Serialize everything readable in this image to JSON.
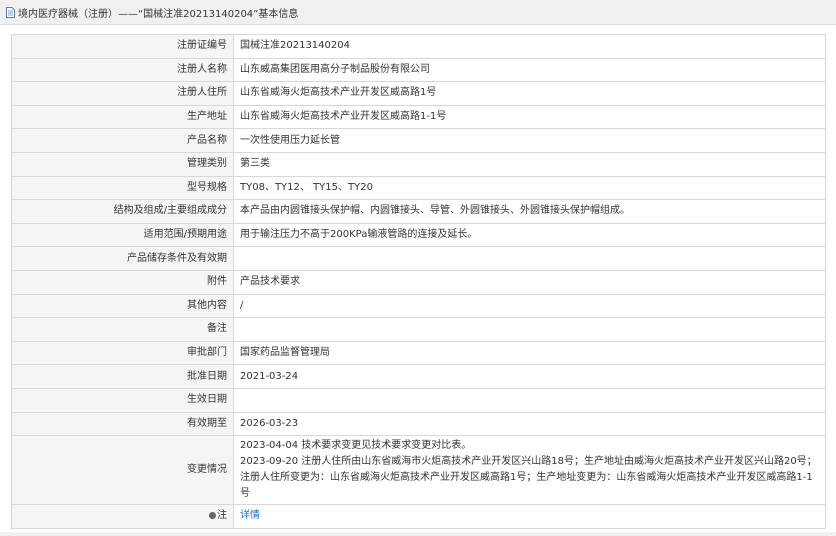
{
  "header": {
    "title": "境内医疗器械（注册）——“国械注准20213140204”基本信息"
  },
  "rows": [
    {
      "label": "注册证编号",
      "value": "国械注准20213140204"
    },
    {
      "label": "注册人名称",
      "value": "山东威高集团医用高分子制品股份有限公司"
    },
    {
      "label": "注册人住所",
      "value": "山东省威海火炬高技术产业开发区威高路1号"
    },
    {
      "label": "生产地址",
      "value": "山东省威海火炬高技术产业开发区威高路1-1号"
    },
    {
      "label": "产品名称",
      "value": "一次性使用压力延长管"
    },
    {
      "label": "管理类别",
      "value": "第三类"
    },
    {
      "label": "型号规格",
      "value": "TY08、TY12、 TY15、TY20"
    },
    {
      "label": "结构及组成/主要组成成分",
      "value": "本产品由内圆锥接头保护帽、内圆锥接头、导管、外圆锥接头、外圆锥接头保护帽组成。"
    },
    {
      "label": "适用范围/预期用途",
      "value": "用于输注压力不高于200KPa输液管路的连接及延长。"
    },
    {
      "label": "产品储存条件及有效期",
      "value": ""
    },
    {
      "label": "附件",
      "value": "产品技术要求"
    },
    {
      "label": "其他内容",
      "value": "/"
    },
    {
      "label": "备注",
      "value": ""
    },
    {
      "label": "审批部门",
      "value": "国家药品监督管理局"
    },
    {
      "label": "批准日期",
      "value": "2021-03-24"
    },
    {
      "label": "生效日期",
      "value": ""
    },
    {
      "label": "有效期至",
      "value": "2026-03-23"
    }
  ],
  "change": {
    "label": "变更情况",
    "line1": "2023-04-04 技术要求变更见技术要求变更对比表。",
    "line2": "2023-09-20 注册人住所由山东省威海市火炬高技术产业开发区兴山路18号；生产地址由威海火炬高技术产业开发区兴山路20号；注册人住所变更为：山东省威海火炬高技术产业开发区威高路1号；生产地址变更为：山东省威海火炬高技术产业开发区威高路1-1号"
  },
  "note": {
    "label": "注",
    "link": "详情"
  }
}
